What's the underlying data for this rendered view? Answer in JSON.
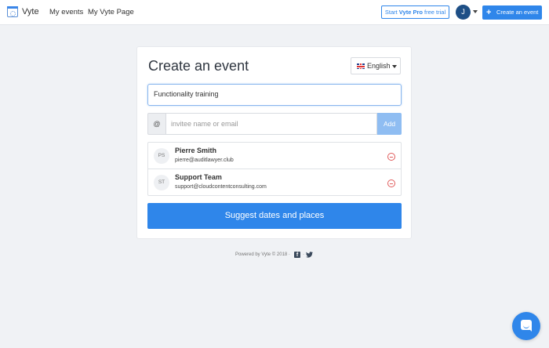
{
  "header": {
    "brand": "Vyte",
    "nav": [
      "My events",
      "My Vyte Page"
    ],
    "trial_prefix": "Start ",
    "trial_bold": "Vyte Pro",
    "trial_suffix": " free trial",
    "avatar_initial": "J",
    "create_label": "Create an event",
    "create_icon": "+"
  },
  "card": {
    "title": "Create an event",
    "language": "English",
    "event_title_value": "Functionality training",
    "invite": {
      "prefix": "@",
      "placeholder": "invitee name or email",
      "add_label": "Add"
    },
    "invitees": [
      {
        "initials": "PS",
        "name": "Pierre Smith",
        "email": "pierre@auditlawyer.club"
      },
      {
        "initials": "ST",
        "name": "Support Team",
        "email": "support@cloudcontentconsulting.com"
      }
    ],
    "suggest_label": "Suggest dates and places"
  },
  "footer": {
    "text": "Powered by Vyte © 2018 ·",
    "facebook_glyph": "f",
    "separator": "·"
  },
  "colors": {
    "accent": "#2f86ea",
    "avatar": "#1e4f86",
    "remove": "#e05a5a",
    "background": "#f0f2f5"
  },
  "icons": [
    "vyte-logo-icon",
    "flag-uk-icon",
    "remove-circle-icon",
    "facebook-icon",
    "twitter-icon",
    "chat-icon",
    "plus-icon",
    "caret-down-icon"
  ]
}
